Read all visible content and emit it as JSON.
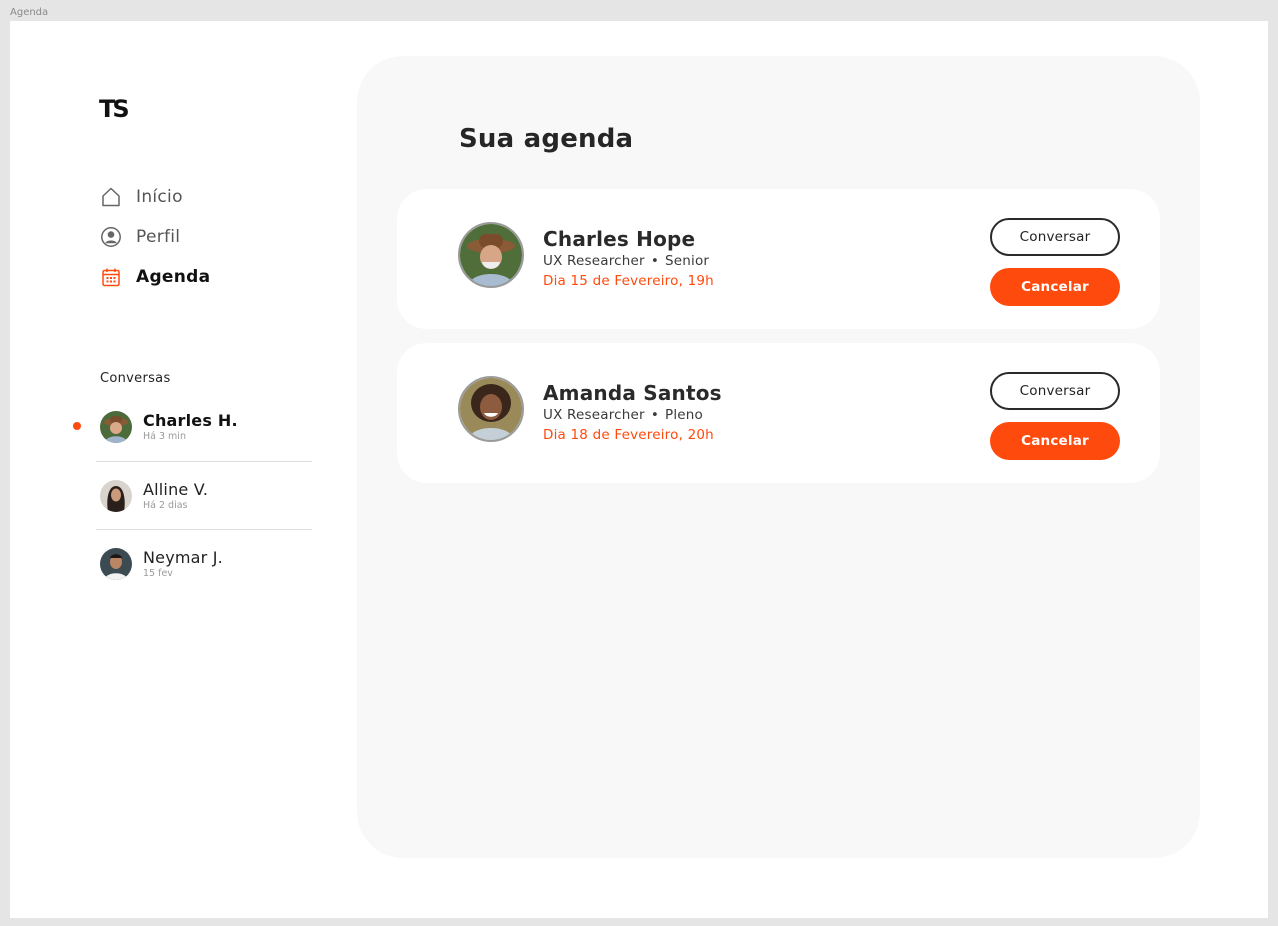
{
  "frame_label": "Agenda",
  "logo": "TS",
  "nav": [
    {
      "label": "Início",
      "icon": "home-icon",
      "active": false
    },
    {
      "label": "Perfil",
      "icon": "user-icon",
      "active": false
    },
    {
      "label": "Agenda",
      "icon": "calendar-icon",
      "active": true
    }
  ],
  "conversations": {
    "title": "Conversas",
    "items": [
      {
        "name": "Charles H.",
        "time": "Há 3 min",
        "unread": true
      },
      {
        "name": "Alline V.",
        "time": "Há 2 dias",
        "unread": false
      },
      {
        "name": "Neymar J.",
        "time": "15 fev",
        "unread": false
      }
    ]
  },
  "main": {
    "title": "Sua agenda",
    "appointments": [
      {
        "name": "Charles Hope",
        "role": "UX Researcher",
        "level": "Senior",
        "date": "Dia 15 de Fevereiro, 19h",
        "chat_label": "Conversar",
        "cancel_label": "Cancelar"
      },
      {
        "name": "Amanda Santos",
        "role": "UX Researcher",
        "level": "Pleno",
        "date": "Dia 18 de Fevereiro, 20h",
        "chat_label": "Conversar",
        "cancel_label": "Cancelar"
      }
    ]
  },
  "colors": {
    "accent": "#ff4a0e",
    "panel": "#f8f8f8",
    "text": "#1f1f1f"
  },
  "separator": "•"
}
